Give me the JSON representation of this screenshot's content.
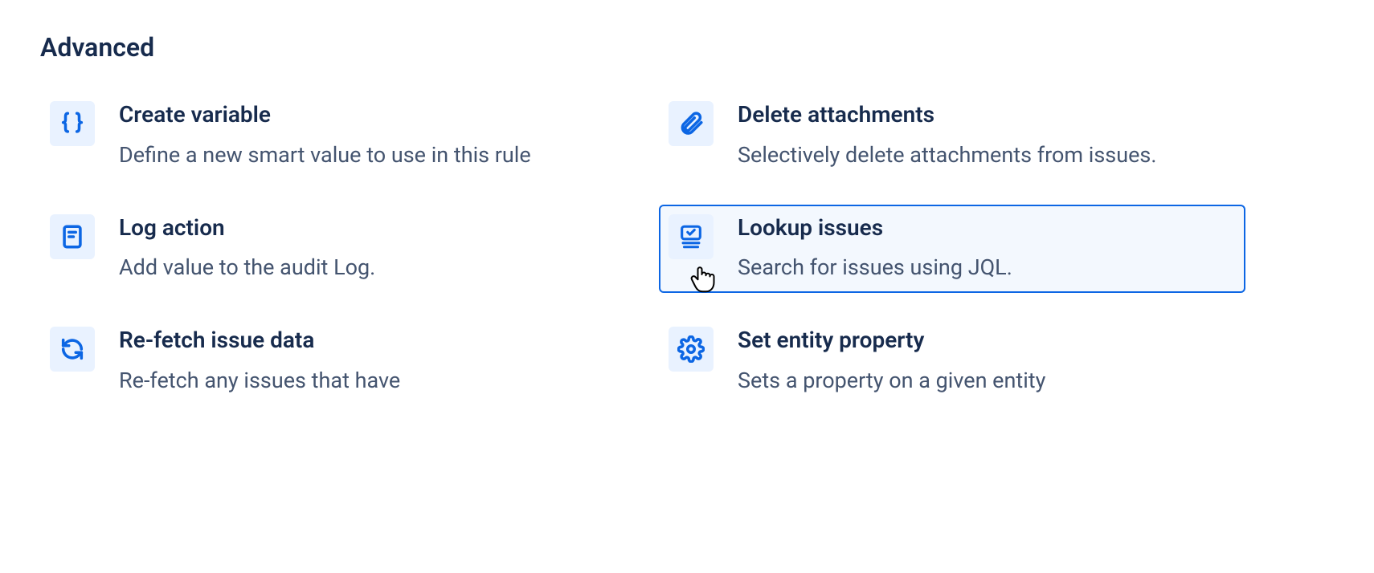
{
  "section": {
    "heading": "Advanced"
  },
  "cards": {
    "create_variable": {
      "title": "Create variable",
      "desc": "Define a new smart value to use in this rule"
    },
    "delete_attachments": {
      "title": "Delete attachments",
      "desc": "Selectively delete attachments from issues."
    },
    "log_action": {
      "title": "Log action",
      "desc": "Add value to the audit Log."
    },
    "lookup_issues": {
      "title": "Lookup issues",
      "desc": "Search for issues using JQL."
    },
    "refetch": {
      "title": "Re-fetch issue data",
      "desc": "Re-fetch any issues that have"
    },
    "set_entity_property": {
      "title": "Set entity property",
      "desc": "Sets a property on a given entity"
    }
  }
}
